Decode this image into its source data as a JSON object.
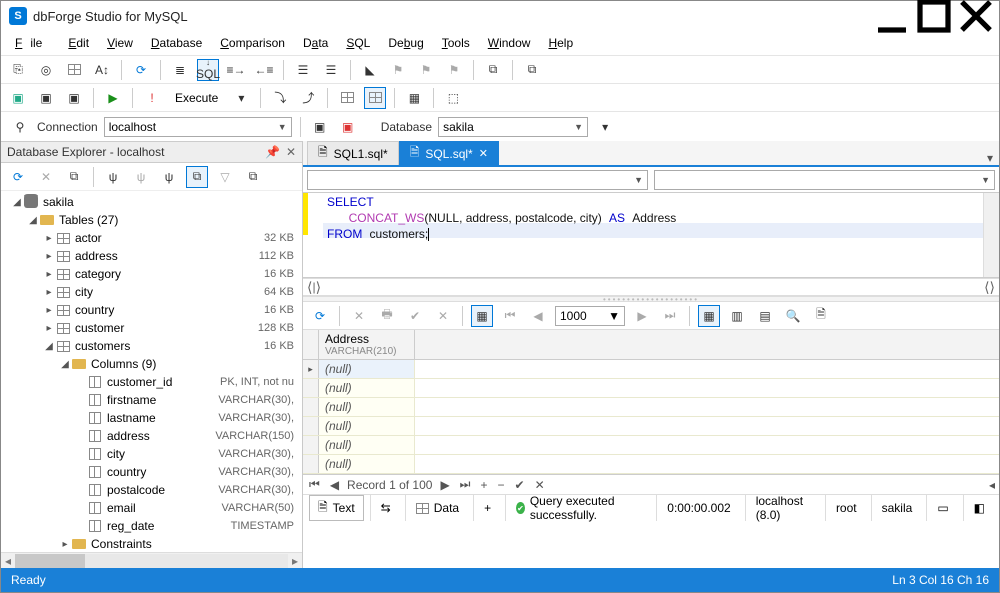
{
  "window": {
    "title": "dbForge Studio for MySQL",
    "logo_letter": "S"
  },
  "menu": [
    "File",
    "Edit",
    "View",
    "Database",
    "Comparison",
    "Data",
    "SQL",
    "Debug",
    "Tools",
    "Window",
    "Help"
  ],
  "toolbar2": {
    "execute_label": "Execute"
  },
  "connbar": {
    "connection_label": "Connection",
    "connection_value": "localhost",
    "database_label": "Database",
    "database_value": "sakila"
  },
  "explorer": {
    "title": "Database Explorer - localhost",
    "db": "sakila",
    "tables_label": "Tables (27)",
    "tables": [
      {
        "name": "actor",
        "size": "32 KB"
      },
      {
        "name": "address",
        "size": "112 KB"
      },
      {
        "name": "category",
        "size": "16 KB"
      },
      {
        "name": "city",
        "size": "64 KB"
      },
      {
        "name": "country",
        "size": "16 KB"
      },
      {
        "name": "customer",
        "size": "128 KB"
      },
      {
        "name": "customers",
        "size": "16 KB",
        "expanded": true
      }
    ],
    "columns_label": "Columns (9)",
    "columns": [
      {
        "name": "customer_id",
        "type": "PK, INT, not nu"
      },
      {
        "name": "firstname",
        "type": "VARCHAR(30),"
      },
      {
        "name": "lastname",
        "type": "VARCHAR(30),"
      },
      {
        "name": "address",
        "type": "VARCHAR(150)"
      },
      {
        "name": "city",
        "type": "VARCHAR(30),"
      },
      {
        "name": "country",
        "type": "VARCHAR(30),"
      },
      {
        "name": "postalcode",
        "type": "VARCHAR(30),"
      },
      {
        "name": "email",
        "type": "VARCHAR(50)"
      },
      {
        "name": "reg_date",
        "type": "TIMESTAMP"
      }
    ],
    "constraints_label": "Constraints"
  },
  "tabs": [
    {
      "label": "SQL1.sql*",
      "active": false
    },
    {
      "label": "SQL.sql*",
      "active": true
    }
  ],
  "sql": {
    "kw_select": "SELECT",
    "fn": "CONCAT_WS",
    "args": "(NULL, address, postalcode, city)",
    "kw_as": "AS",
    "alias": "Address",
    "kw_from": "FROM",
    "tbl": "customers",
    "semi": ";"
  },
  "gridtools": {
    "page_size": "1000"
  },
  "results": {
    "col_name": "Address",
    "col_type": "VARCHAR(210)",
    "cell_null": "(null)",
    "record_label": "Record 1 of 100"
  },
  "footer": {
    "text_label": "Text",
    "data_label": "Data",
    "status": "Query executed successfully.",
    "elapsed": "0:00:00.002",
    "host": "localhost (8.0)",
    "user": "root",
    "db": "sakila"
  },
  "statusbar": {
    "ready": "Ready",
    "pos": "Ln 3    Col 16    Ch 16"
  }
}
